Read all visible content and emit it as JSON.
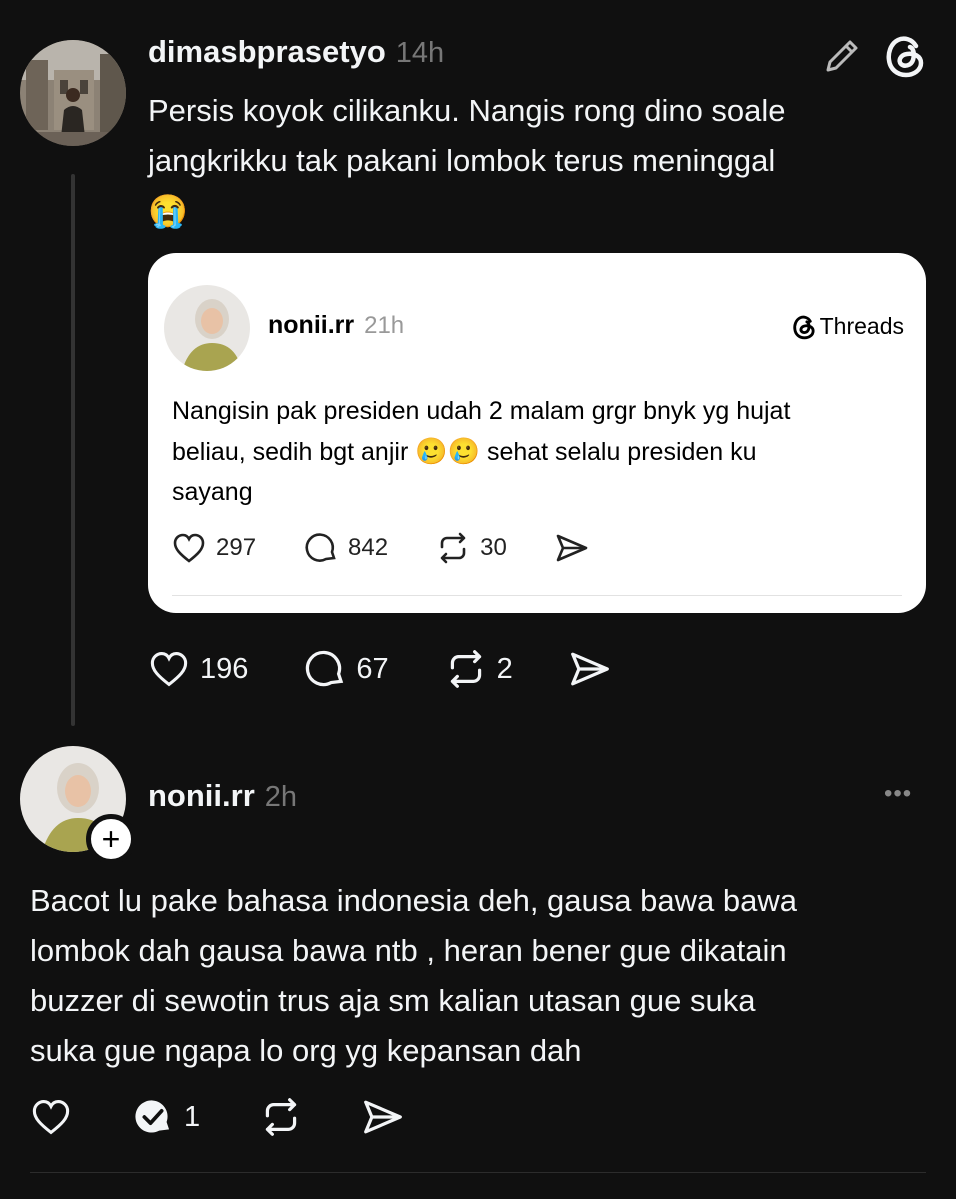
{
  "post": {
    "username": "dimasbprasetyo",
    "time": "14h",
    "text_line1": "Persis koyok cilikanku. Nangis rong dino soale",
    "text_line2": "jangkrikku tak pakani lombok terus meninggal",
    "emoji": "😭",
    "likes": "196",
    "replies": "67",
    "reposts": "2"
  },
  "quoted": {
    "username": "nonii.rr",
    "time": "21h",
    "brand": "Threads",
    "line1": "Nangisin pak presiden udah 2 malam grgr bnyk yg hujat",
    "line2_a": "beliau, sedih bgt anjir",
    "line2_emoji": "🥲🥲",
    "line2_b": "sehat selalu presiden ku",
    "line3": "sayang",
    "likes": "297",
    "replies": "842",
    "reposts": "30"
  },
  "reply": {
    "username": "nonii.rr",
    "time": "2h",
    "more": "•••",
    "follow": "+",
    "line1": "Bacot lu pake bahasa indonesia deh, gausa bawa bawa",
    "line2": "lombok dah gausa bawa ntb , heran bener gue dikatain",
    "line3": "buzzer di sewotin trus aja sm kalian utasan gue suka",
    "line4": "suka gue ngapa lo org yg kepansan dah",
    "replies": "1"
  },
  "colors": {
    "background": "#101010",
    "text": "#f3f5f7",
    "muted": "#777777",
    "card": "#ffffff"
  },
  "icons": [
    "edit-icon",
    "threads-logo-icon",
    "heart-icon",
    "comment-icon",
    "repost-icon",
    "share-icon",
    "more-icon",
    "plus-icon"
  ]
}
